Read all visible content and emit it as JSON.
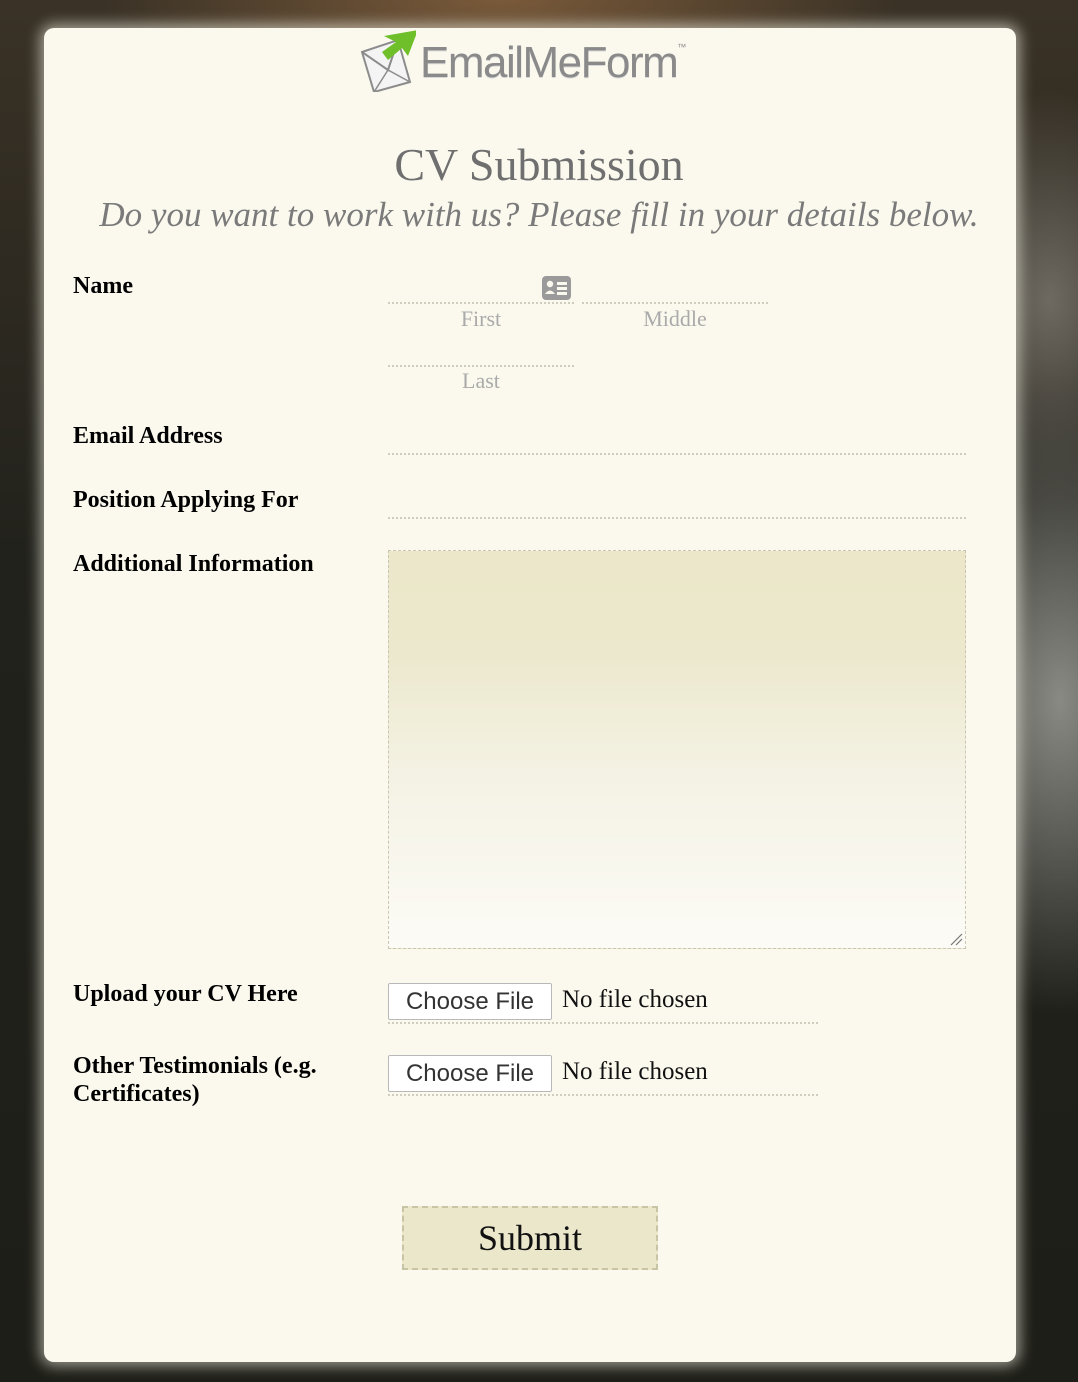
{
  "logo": {
    "text": "EmailMeForm",
    "tm": "™"
  },
  "form": {
    "title": "CV Submission",
    "subtitle": "Do you want to work with us? Please fill in your details below."
  },
  "fields": {
    "name": {
      "label": "Name",
      "first": "First",
      "middle": "Middle",
      "last": "Last",
      "icon": "contact-card-icon"
    },
    "email": {
      "label": "Email Address"
    },
    "position": {
      "label": "Position Applying For"
    },
    "additional": {
      "label": "Additional Information"
    },
    "cv_upload": {
      "label": "Upload your CV Here",
      "button": "Choose File",
      "status": "No file chosen"
    },
    "testimonials": {
      "label_line1": "Other Testimonials (e.g.",
      "label_line2": "Certificates)",
      "button": "Choose File",
      "status": "No file chosen"
    }
  },
  "submit": {
    "label": "Submit"
  },
  "colors": {
    "card_bg": "#fbf9ee",
    "accent_field": "#ebe7cb",
    "logo_green": "#6fbf2a"
  }
}
